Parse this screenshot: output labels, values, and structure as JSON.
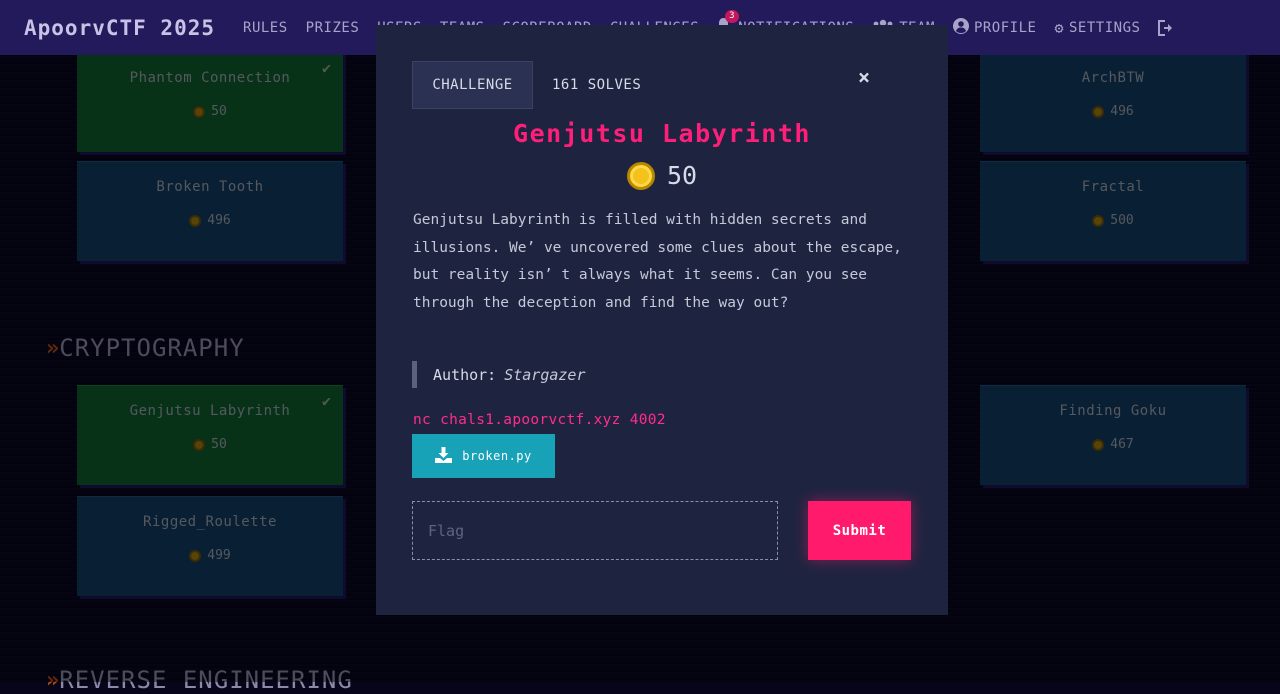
{
  "navbar": {
    "brand": "ApoorvCTF 2025",
    "items": [
      {
        "label": "RULES"
      },
      {
        "label": "PRIZES"
      },
      {
        "label": "USERS"
      },
      {
        "label": "TEAMS"
      },
      {
        "label": "SCOREBOARD"
      },
      {
        "label": "CHALLENGES"
      }
    ],
    "notifications": {
      "label": "NOTIFICATIONS",
      "count": "3"
    },
    "team": {
      "label": "TEAM"
    },
    "profile": {
      "label": "PROFILE"
    },
    "settings": {
      "label": "SETTINGS"
    }
  },
  "categories": [
    {
      "name": "CRYPTOGRAPHY"
    },
    {
      "name": "REVERSE ENGINEERING"
    }
  ],
  "cards": [
    {
      "name": "Phantom Connection",
      "points": "50",
      "solved": true
    },
    {
      "name": "ArchBTW",
      "points": "496",
      "solved": false
    },
    {
      "name": "Broken Tooth",
      "points": "496",
      "solved": false
    },
    {
      "name": "Fractal",
      "points": "500",
      "solved": false
    },
    {
      "name": "Genjutsu Labyrinth",
      "points": "50",
      "solved": true
    },
    {
      "name": "Finding Goku",
      "points": "467",
      "solved": false
    },
    {
      "name": "Rigged_Roulette",
      "points": "499",
      "solved": false
    }
  ],
  "modal": {
    "tab_challenge": "CHALLENGE",
    "tab_solves": "161 SOLVES",
    "close": "×",
    "title": "Genjutsu Labyrinth",
    "points": "50",
    "description": "Genjutsu Labyrinth is filled with hidden secrets and illusions. We’   ve uncovered some clues about the escape, but reality isn’   t always what it seems. Can you see through the deception and find the way out?",
    "author_label": "Author:",
    "author_name": "Stargazer",
    "connection": "nc chals1.apoorvctf.xyz 4002",
    "download_label": "broken.py",
    "flag_placeholder": "Flag",
    "flag_value": "",
    "submit_label": "Submit"
  },
  "colors": {
    "accent": "#ff1a6c",
    "title": "#ff1f7a",
    "navbar": "#231a5c",
    "solved_card": "#0e5c2c",
    "unsolved_card": "#123a5e",
    "download_button": "#17a2b8"
  }
}
